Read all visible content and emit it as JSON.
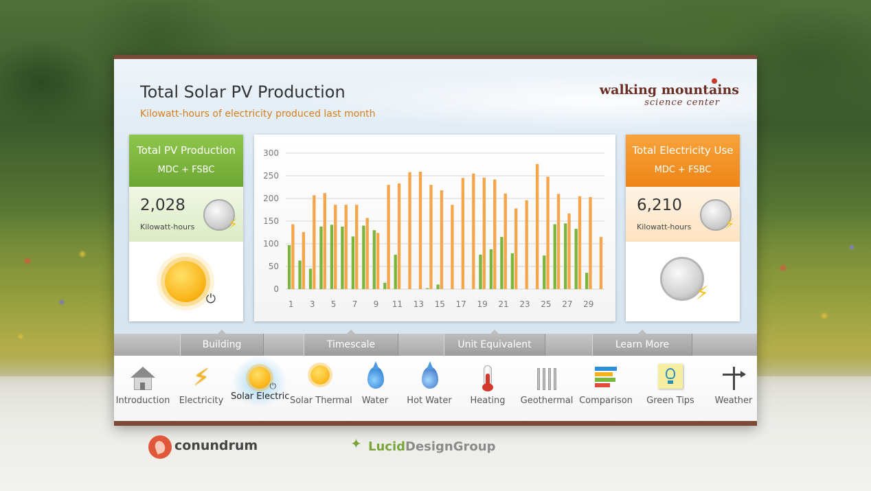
{
  "header": {
    "title": "Total Solar PV Production",
    "subtitle": "Kilowatt-hours of electricity produced last month",
    "brand_name": "walking mountains",
    "brand_sub": "science center"
  },
  "left_card": {
    "title": "Total PV Production",
    "subtitle": "MDC + FSBC",
    "value": "2,028",
    "unit": "Kilowatt-hours",
    "accent": "#7ab53d"
  },
  "right_card": {
    "title": "Total Electricity Use",
    "subtitle": "MDC + FSBC",
    "value": "6,210",
    "unit": "Kilowatt-hours",
    "accent": "#f29a26"
  },
  "chart_data": {
    "type": "bar",
    "x": [
      1,
      2,
      3,
      4,
      5,
      6,
      7,
      8,
      9,
      10,
      11,
      12,
      13,
      14,
      15,
      16,
      17,
      18,
      19,
      20,
      21,
      22,
      23,
      24,
      25,
      26,
      27,
      28,
      29,
      30
    ],
    "xticks": [
      "1",
      "3",
      "5",
      "7",
      "9",
      "11",
      "13",
      "15",
      "17",
      "19",
      "21",
      "23",
      "25",
      "27",
      "29"
    ],
    "yticks": [
      "0",
      "50",
      "100",
      "150",
      "200",
      "250",
      "300"
    ],
    "ylim": [
      0,
      300
    ],
    "grid": true,
    "series": [
      {
        "color": "#7ab53d",
        "values": [
          97,
          63,
          45,
          138,
          142,
          138,
          116,
          140,
          130,
          14,
          76,
          0,
          0,
          2,
          10,
          0,
          0,
          0,
          76,
          88,
          115,
          79,
          0,
          0,
          74,
          143,
          145,
          133,
          36,
          0
        ]
      },
      {
        "color": "#f5a54a",
        "values": [
          143,
          126,
          207,
          212,
          186,
          186,
          186,
          157,
          124,
          230,
          233,
          258,
          259,
          230,
          218,
          186,
          245,
          255,
          246,
          242,
          211,
          178,
          196,
          276,
          248,
          210,
          167,
          205,
          203,
          115
        ]
      }
    ]
  },
  "tabs": [
    {
      "label": "Building"
    },
    {
      "label": "Timescale"
    },
    {
      "label": "Unit Equivalent"
    },
    {
      "label": "Learn More"
    }
  ],
  "nav": [
    {
      "label": "Introduction",
      "icon": "house-icon"
    },
    {
      "label": "Electricity",
      "icon": "lightning-bolt-icon"
    },
    {
      "label": "Solar Electric",
      "icon": "sun-plug-icon",
      "active": true
    },
    {
      "label": "Solar Thermal",
      "icon": "sun-thermometer-icon"
    },
    {
      "label": "Water",
      "icon": "water-drop-icon"
    },
    {
      "label": "Hot Water",
      "icon": "hot-water-drop-icon"
    },
    {
      "label": "Heating",
      "icon": "thermometer-icon"
    },
    {
      "label": "Geothermal",
      "icon": "geothermal-pipes-icon"
    },
    {
      "label": "Comparison",
      "icon": "bar-chart-icon"
    },
    {
      "label": "Green Tips",
      "icon": "light-bulb-note-icon"
    },
    {
      "label": "Weather",
      "icon": "weather-vane-icon"
    }
  ],
  "footer": {
    "logo1": "conundrum",
    "logo2_a": "Lucid",
    "logo2_b": "DesignGroup"
  },
  "colors": {
    "panel_border": "#7a4a37",
    "title_accent": "#d47f1e",
    "active_nav_glow": "#96d2f5"
  }
}
